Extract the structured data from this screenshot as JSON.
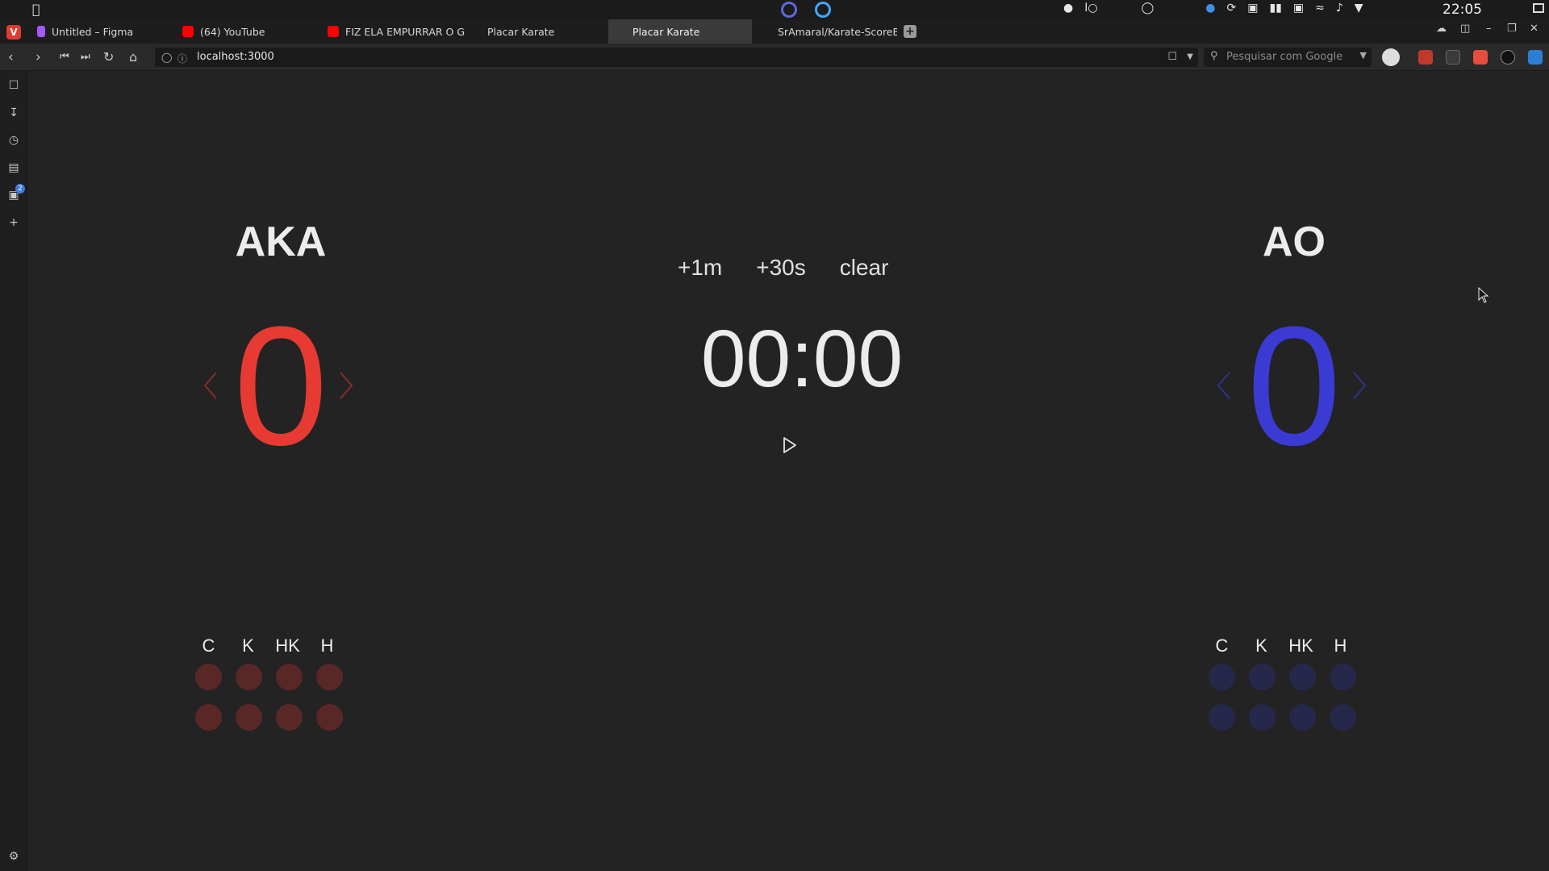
{
  "system_bar": {
    "clock": "22:05"
  },
  "tabs": [
    {
      "label": "Untitled – Figma",
      "fav_color": "#a259ff"
    },
    {
      "label": "(64) YouTube",
      "fav_color": "#ff0000"
    },
    {
      "label": "FIZ ELA EMPURRAR O GOL",
      "fav_color": "#ff0000"
    },
    {
      "label": "Placar Karate",
      "fav_color": ""
    },
    {
      "label": "Placar Karate",
      "fav_color": "",
      "active": true
    },
    {
      "label": "SrAmaral/Karate-ScoreBoa",
      "fav_color": ""
    }
  ],
  "address_bar": {
    "url": "localhost:3000",
    "search_placeholder": "Pesquisar com Google"
  },
  "side_panel": {
    "badge_count": "2"
  },
  "scoreboard": {
    "aka": {
      "name": "AKA",
      "score": "0",
      "color": "#e63a32",
      "dot_color": "#5a2727",
      "arrow_color": "#8a2d26",
      "penalty_labels": [
        "C",
        "K",
        "HK",
        "H"
      ]
    },
    "ao": {
      "name": "AO",
      "score": "0",
      "color": "#3b3bd3",
      "dot_color": "#25284a",
      "arrow_color": "#2f3290",
      "penalty_labels": [
        "C",
        "K",
        "HK",
        "H"
      ]
    },
    "timer": {
      "add_minute": "+1m",
      "add_seconds": "+30s",
      "clear": "clear",
      "display": "00:00"
    }
  }
}
